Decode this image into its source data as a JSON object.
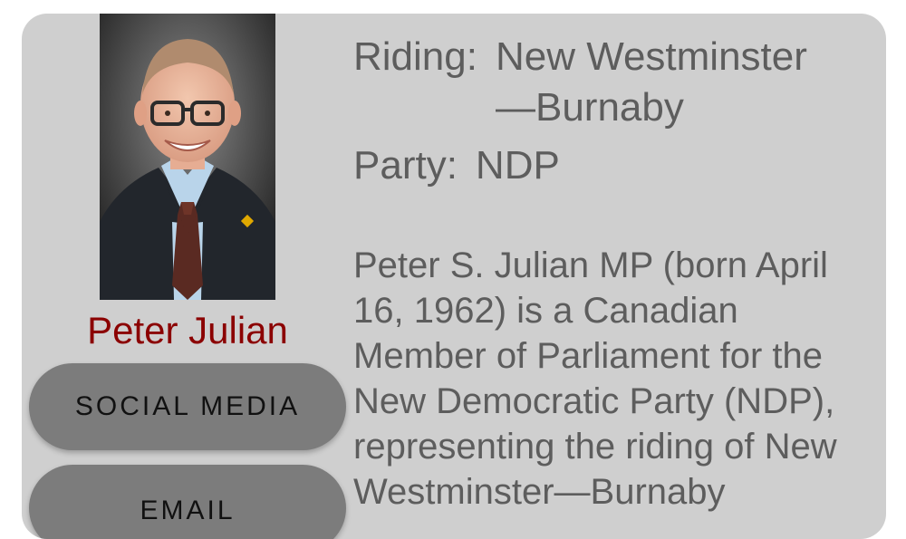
{
  "mp": {
    "name": "Peter Julian",
    "riding_label": "Riding:",
    "riding_value": "New Westminster —Burnaby",
    "party_label": "Party:",
    "party_value": "NDP",
    "bio": "Peter S. Julian MP (born April 16, 1962) is a Canadian Member of Parliament for the New Democratic Party (NDP), representing the riding of New Westminster—Burnaby"
  },
  "buttons": {
    "social_media": "SOCIAL MEDIA",
    "email": "EMAIL"
  },
  "colors": {
    "card_bg": "#cfcfcf",
    "name_color": "#8b0000",
    "button_bg": "#7c7c7c",
    "text_color": "#5d5d5d"
  }
}
